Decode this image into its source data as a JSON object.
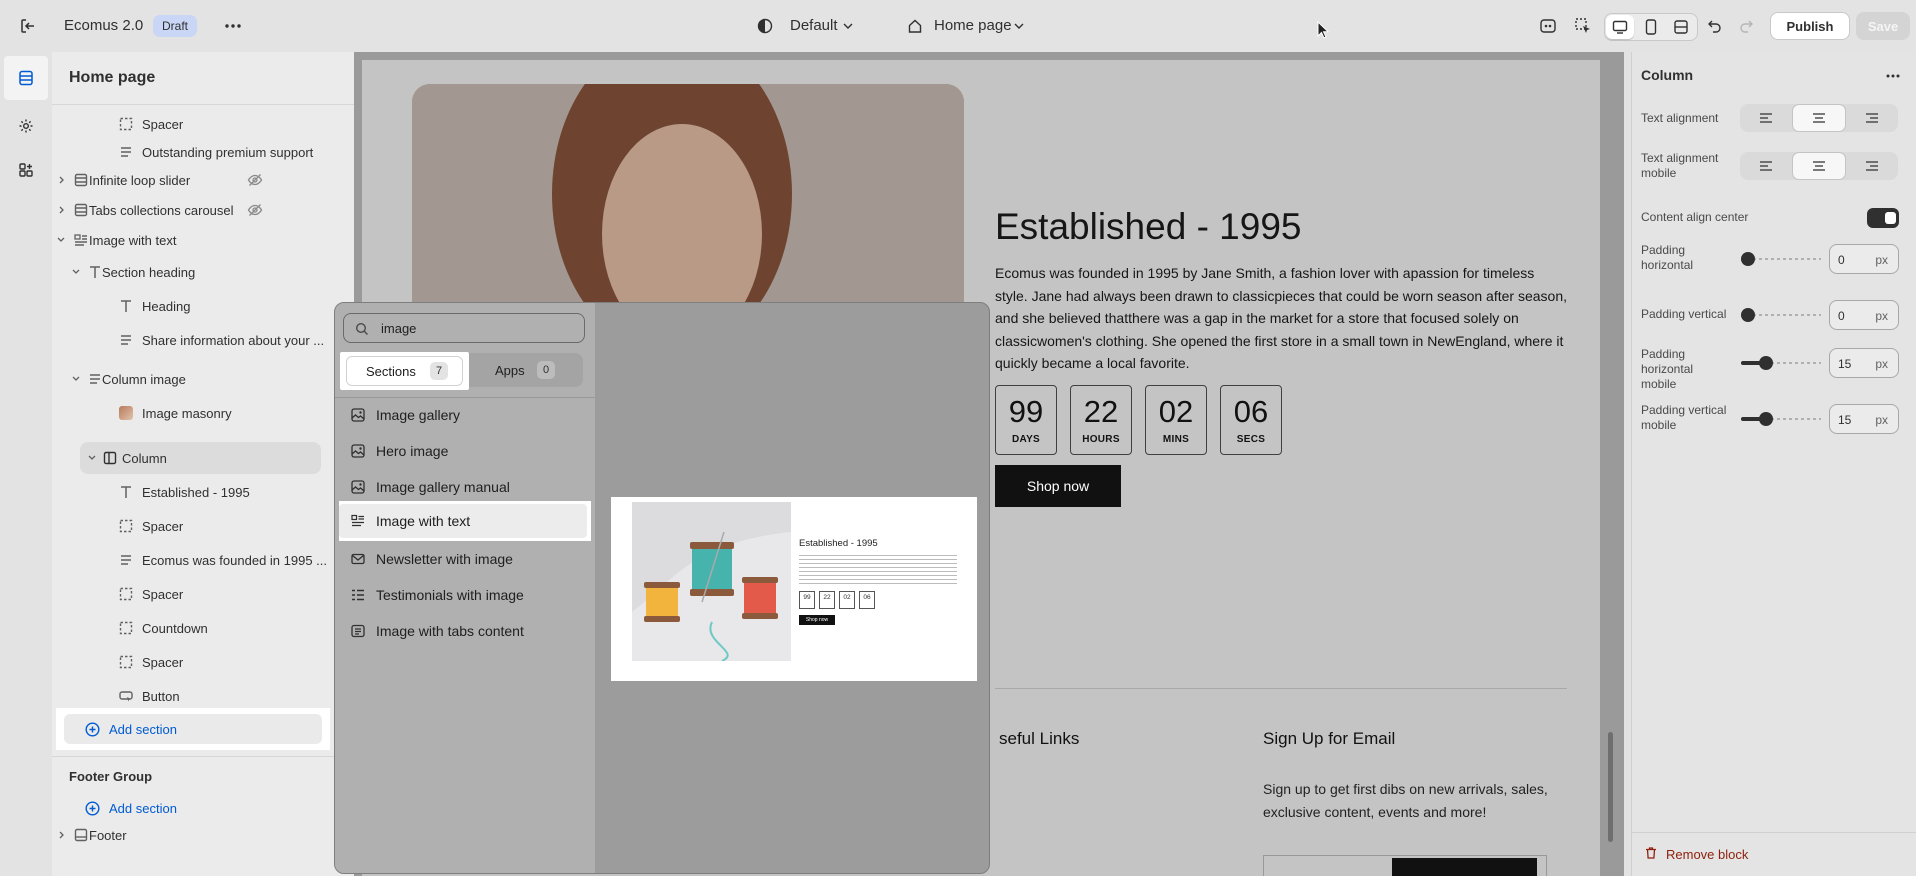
{
  "topbar": {
    "store_name": "Ecomus 2.0",
    "draft_badge": "Draft",
    "theme_select": "Default",
    "page_select": "Home page",
    "publish": "Publish",
    "save": "Save"
  },
  "sidebar": {
    "title": "Home page",
    "items": [
      {
        "label": "Spacer",
        "icon": "spacer-icon"
      },
      {
        "label": "Outstanding premium support",
        "icon": "text-lines-icon"
      },
      {
        "label": "Infinite loop slider",
        "icon": "section-icon",
        "hidden": true
      },
      {
        "label": "Tabs collections carousel",
        "icon": "section-icon",
        "hidden": true
      },
      {
        "label": "Image with text",
        "icon": "image-text-icon"
      },
      {
        "label": "Section heading",
        "icon": "type-icon"
      },
      {
        "label": "Heading",
        "icon": "type-icon"
      },
      {
        "label": "Share information about your ...",
        "icon": "text-lines-icon"
      },
      {
        "label": "Column image",
        "icon": "text-lines-icon"
      },
      {
        "label": "Image masonry",
        "icon": "thumbnail-icon"
      },
      {
        "label": "Column",
        "icon": "column-icon"
      },
      {
        "label": "Established - 1995",
        "icon": "type-icon"
      },
      {
        "label": "Spacer",
        "icon": "spacer-icon"
      },
      {
        "label": "Ecomus was founded in 1995 ...",
        "icon": "text-lines-icon"
      },
      {
        "label": "Spacer",
        "icon": "spacer-icon"
      },
      {
        "label": "Countdown",
        "icon": "spacer-icon"
      },
      {
        "label": "Spacer",
        "icon": "spacer-icon"
      },
      {
        "label": "Button",
        "icon": "button-icon"
      }
    ],
    "add_section": "Add section",
    "footer_group": "Footer Group",
    "footer_add_section": "Add section",
    "footer": "Footer"
  },
  "preview": {
    "heading": "Established - 1995",
    "body": "Ecomus was founded in 1995 by Jane Smith, a fashion lover with apassion for timeless style. Jane had always been drawn to classicpieces that could be worn season after season, and she believed thatthere was a gap in the market for a store that focused solely on classicwomen's clothing. She opened the first store in a small town in NewEngland, where it quickly became a local favorite.",
    "countdown": [
      {
        "n": "99",
        "l": "DAYS"
      },
      {
        "n": "22",
        "l": "HOURS"
      },
      {
        "n": "02",
        "l": "MINS"
      },
      {
        "n": "06",
        "l": "SECS"
      }
    ],
    "shop_now": "Shop now",
    "useful_links": "seful Links",
    "signup_title": "Sign Up for Email",
    "signup_text": "Sign up to get first dibs on new arrivals, sales, exclusive content, events and more!"
  },
  "picker": {
    "search_value": "image",
    "tabs": [
      {
        "label": "Sections",
        "count": "7"
      },
      {
        "label": "Apps",
        "count": "0"
      }
    ],
    "items": [
      "Image gallery",
      "Hero image",
      "Image gallery manual",
      "Image with text",
      "Newsletter with image",
      "Testimonials with image",
      "Image with tabs content"
    ],
    "selected": "Image with text",
    "thumb": {
      "heading": "Established - 1995",
      "countdown": [
        "99",
        "22",
        "02",
        "06"
      ],
      "button": "Shop now"
    }
  },
  "settings": {
    "title": "Column",
    "text_alignment": "Text alignment",
    "text_alignment_selected": "center",
    "text_alignment_mobile": "Text alignment mobile",
    "text_alignment_mobile_selected": "center",
    "content_align_center": "Content align center",
    "content_align_center_on": true,
    "padding_horizontal": {
      "label": "Padding horizontal",
      "value": "0",
      "unit": "px"
    },
    "padding_vertical": {
      "label": "Padding vertical",
      "value": "0",
      "unit": "px"
    },
    "padding_horizontal_mobile": {
      "label": "Padding horizontal mobile",
      "value": "15",
      "unit": "px"
    },
    "padding_vertical_mobile": {
      "label": "Padding vertical mobile",
      "value": "15",
      "unit": "px"
    },
    "remove_block": "Remove block"
  },
  "colors": {
    "accent_blue": "#005bd3",
    "dark": "#303030",
    "danger": "#8e1f0b"
  }
}
